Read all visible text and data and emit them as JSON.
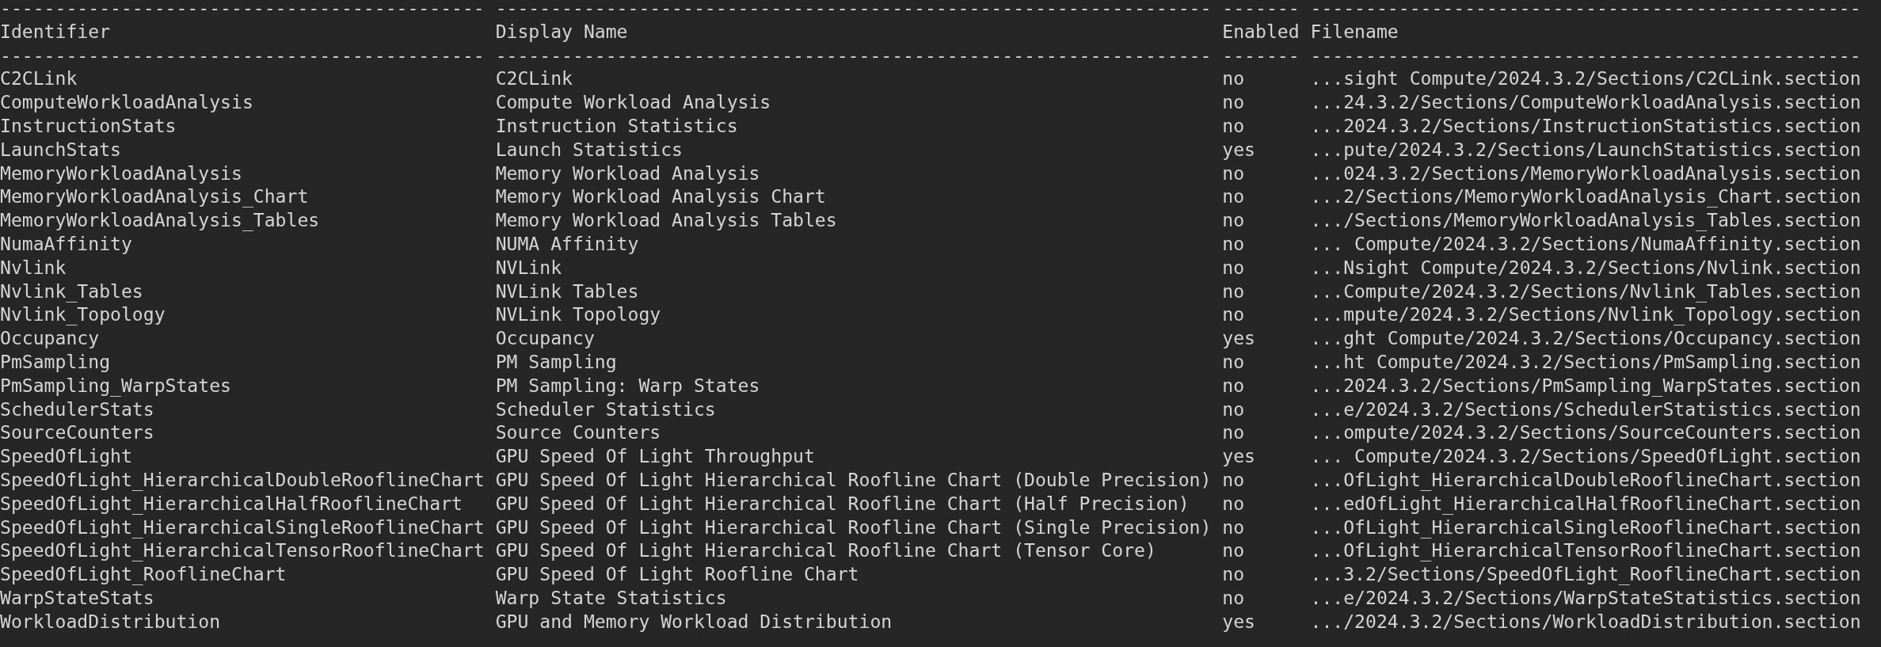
{
  "table": {
    "separator_top": [
      "--------------------------------------------",
      "-----------------------------------------------------------------",
      "-------",
      "--------------------------------------------------"
    ],
    "columns": [
      "Identifier",
      "Display Name",
      "Enabled",
      "Filename"
    ],
    "separator_bottom": [
      "--------------------------------------------",
      "-----------------------------------------------------------------",
      "-------",
      "--------------------------------------------------"
    ],
    "rows": [
      [
        "C2CLink",
        "C2CLink",
        "no",
        "...sight Compute/2024.3.2/Sections/C2CLink.section"
      ],
      [
        "ComputeWorkloadAnalysis",
        "Compute Workload Analysis",
        "no",
        "...24.3.2/Sections/ComputeWorkloadAnalysis.section"
      ],
      [
        "InstructionStats",
        "Instruction Statistics",
        "no",
        "...2024.3.2/Sections/InstructionStatistics.section"
      ],
      [
        "LaunchStats",
        "Launch Statistics",
        "yes",
        "...pute/2024.3.2/Sections/LaunchStatistics.section"
      ],
      [
        "MemoryWorkloadAnalysis",
        "Memory Workload Analysis",
        "no",
        "...024.3.2/Sections/MemoryWorkloadAnalysis.section"
      ],
      [
        "MemoryWorkloadAnalysis_Chart",
        "Memory Workload Analysis Chart",
        "no",
        "...2/Sections/MemoryWorkloadAnalysis_Chart.section"
      ],
      [
        "MemoryWorkloadAnalysis_Tables",
        "Memory Workload Analysis Tables",
        "no",
        ".../Sections/MemoryWorkloadAnalysis_Tables.section"
      ],
      [
        "NumaAffinity",
        "NUMA Affinity",
        "no",
        "... Compute/2024.3.2/Sections/NumaAffinity.section"
      ],
      [
        "Nvlink",
        "NVLink",
        "no",
        "...Nsight Compute/2024.3.2/Sections/Nvlink.section"
      ],
      [
        "Nvlink_Tables",
        "NVLink Tables",
        "no",
        "...Compute/2024.3.2/Sections/Nvlink_Tables.section"
      ],
      [
        "Nvlink_Topology",
        "NVLink Topology",
        "no",
        "...mpute/2024.3.2/Sections/Nvlink_Topology.section"
      ],
      [
        "Occupancy",
        "Occupancy",
        "yes",
        "...ght Compute/2024.3.2/Sections/Occupancy.section"
      ],
      [
        "PmSampling",
        "PM Sampling",
        "no",
        "...ht Compute/2024.3.2/Sections/PmSampling.section"
      ],
      [
        "PmSampling_WarpStates",
        "PM Sampling: Warp States",
        "no",
        "...2024.3.2/Sections/PmSampling_WarpStates.section"
      ],
      [
        "SchedulerStats",
        "Scheduler Statistics",
        "no",
        "...e/2024.3.2/Sections/SchedulerStatistics.section"
      ],
      [
        "SourceCounters",
        "Source Counters",
        "no",
        "...ompute/2024.3.2/Sections/SourceCounters.section"
      ],
      [
        "SpeedOfLight",
        "GPU Speed Of Light Throughput",
        "yes",
        "... Compute/2024.3.2/Sections/SpeedOfLight.section"
      ],
      [
        "SpeedOfLight_HierarchicalDoubleRooflineChart",
        "GPU Speed Of Light Hierarchical Roofline Chart (Double Precision)",
        "no",
        "...OfLight_HierarchicalDoubleRooflineChart.section"
      ],
      [
        "SpeedOfLight_HierarchicalHalfRooflineChart",
        "GPU Speed Of Light Hierarchical Roofline Chart (Half Precision)",
        "no",
        "...edOfLight_HierarchicalHalfRooflineChart.section"
      ],
      [
        "SpeedOfLight_HierarchicalSingleRooflineChart",
        "GPU Speed Of Light Hierarchical Roofline Chart (Single Precision)",
        "no",
        "...OfLight_HierarchicalSingleRooflineChart.section"
      ],
      [
        "SpeedOfLight_HierarchicalTensorRooflineChart",
        "GPU Speed Of Light Hierarchical Roofline Chart (Tensor Core)",
        "no",
        "...OfLight_HierarchicalTensorRooflineChart.section"
      ],
      [
        "SpeedOfLight_RooflineChart",
        "GPU Speed Of Light Roofline Chart",
        "no",
        "...3.2/Sections/SpeedOfLight_RooflineChart.section"
      ],
      [
        "WarpStateStats",
        "Warp State Statistics",
        "no",
        "...e/2024.3.2/Sections/WarpStateStatistics.section"
      ],
      [
        "WorkloadDistribution",
        "GPU and Memory Workload Distribution",
        "yes",
        ".../2024.3.2/Sections/WorkloadDistribution.section"
      ]
    ]
  }
}
